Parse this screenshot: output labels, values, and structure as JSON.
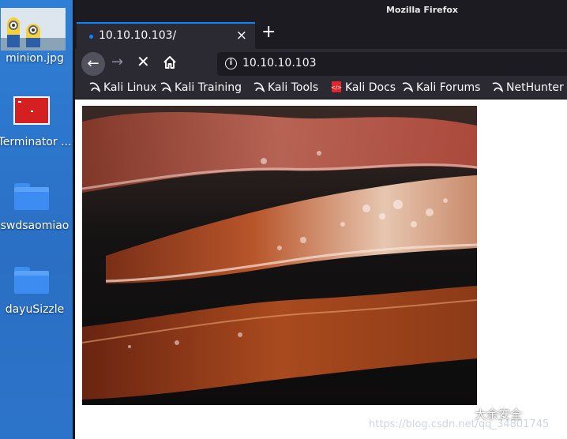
{
  "desktop": {
    "icons": [
      {
        "label": "minion.jpg",
        "icon": "minion-image-icon"
      },
      {
        "label": "Terminator ...",
        "icon": "terminator-icon"
      },
      {
        "label": "swdsaomiao",
        "icon": "folder-icon"
      },
      {
        "label": "dayuSizzle",
        "icon": "folder-icon"
      }
    ]
  },
  "window": {
    "title": "Mozilla Firefox"
  },
  "tab": {
    "title": "10.10.10.103/",
    "close": "×",
    "new_tab": "+"
  },
  "nav": {
    "back": "←",
    "forward": "→",
    "stop": "✕",
    "url": "10.10.10.103"
  },
  "bookmarks": [
    {
      "label": "Kali Linux",
      "icon": "kali-dragon-icon"
    },
    {
      "label": "Kali Training",
      "icon": "kali-dragon-icon"
    },
    {
      "label": "Kali Tools",
      "icon": "kali-dragon-icon"
    },
    {
      "label": "Kali Docs",
      "icon": "kali-docs-icon"
    },
    {
      "label": "Kali Forums",
      "icon": "kali-dragon-icon"
    },
    {
      "label": "NetHunter",
      "icon": "kali-dragon-icon"
    }
  ],
  "page": {
    "image": "bacon-sizzle-image"
  },
  "overlay": {
    "watermark": "大余安全",
    "url_watermark": "https://blog.csdn.net/qq_34801745"
  },
  "colors": {
    "accent": "#0a84ff",
    "toolbar": "#2b2a33",
    "titlebar": "#1c1b22",
    "desktop": "#2a73c9"
  }
}
